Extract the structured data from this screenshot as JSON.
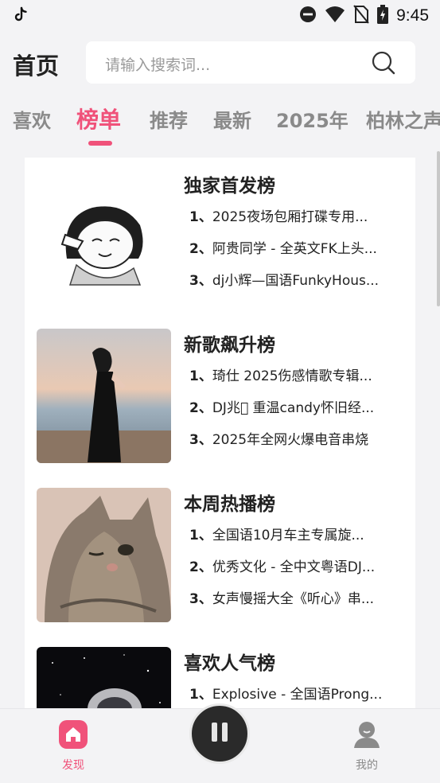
{
  "status_bar": {
    "time": "9:45"
  },
  "header": {
    "title": "首页"
  },
  "search": {
    "placeholder": "请输入搜索词..."
  },
  "tabs": [
    {
      "label": "喜欢"
    },
    {
      "label": "榜单",
      "active": true
    },
    {
      "label": "推荐"
    },
    {
      "label": "最新"
    },
    {
      "label": "2025年"
    },
    {
      "label": "柏林之声"
    }
  ],
  "charts": [
    {
      "title": "独家首发榜",
      "songs": [
        {
          "rank": "1、",
          "text": "2025夜场包厢打碟专用..."
        },
        {
          "rank": "2、",
          "text": "阿贵同学 - 全英文FK上头..."
        },
        {
          "rank": "3、",
          "text": "dj小辉—国语FunkyHous..."
        }
      ]
    },
    {
      "title": "新歌飙升榜",
      "songs": [
        {
          "rank": "1、",
          "text": "琦仕  2025伤感情歌专辑..."
        },
        {
          "rank": "2、",
          "text": "DJ兆\u0000  重温candy怀旧经..."
        },
        {
          "rank": "3、",
          "text": "2025年全网火爆电音串烧"
        }
      ]
    },
    {
      "title": "本周热播榜",
      "songs": [
        {
          "rank": "1、",
          "text": "全国语10月车主专属旋..."
        },
        {
          "rank": "2、",
          "text": "优秀文化 - 全中文粤语DJ..."
        },
        {
          "rank": "3、",
          "text": "女声慢摇大全《听心》串..."
        }
      ]
    },
    {
      "title": "喜欢人气榜",
      "songs": [
        {
          "rank": "1、",
          "text": "Explosive - 全国语Prong..."
        }
      ]
    }
  ],
  "bottom_nav": {
    "discover_label": "发现",
    "mine_label": "我的"
  },
  "colors": {
    "accent": "#f0527a",
    "inactive_tab": "#8a8a8a",
    "background": "#f3f3f5"
  },
  "icons": [
    "tiktok-icon",
    "dnd-icon",
    "wifi-icon",
    "no-sim-icon",
    "battery-icon",
    "search-icon",
    "home-icon",
    "pause-icon",
    "user-icon"
  ]
}
